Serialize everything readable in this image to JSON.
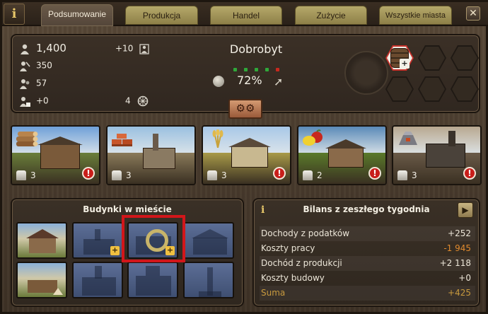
{
  "tabs": [
    {
      "label": "Podsumowanie",
      "active": true
    },
    {
      "label": "Produkcja",
      "active": false
    },
    {
      "label": "Handel",
      "active": false
    },
    {
      "label": "Zużycie",
      "active": false
    },
    {
      "label": "Wszystkie miasta",
      "active": false
    }
  ],
  "info_glyph": "i",
  "close_glyph": "✕",
  "summary": {
    "population": "1,400",
    "population_change": "+10",
    "workers": "350",
    "citizens": "57",
    "newcomers": "+0",
    "carts": "4",
    "title": "Dobrobyt",
    "prosperity_percent": "72%",
    "prosperity_dots": [
      "#2fa83a",
      "#2fa83a",
      "#2fa83a",
      "#2fa83a",
      "#c8281e"
    ],
    "gear_glyph": "⚙⚙"
  },
  "trade_slots": {
    "active_good_plus": "+"
  },
  "buildings": [
    {
      "name": "lumberjack",
      "count": "3",
      "warning": true,
      "icon": "logs-icon",
      "sky": "#6fa0d8",
      "ground": "#6a7f3a"
    },
    {
      "name": "brickworks",
      "count": "3",
      "warning": false,
      "icon": "bricks-icon",
      "sky": "#9ac0e0",
      "ground": "#8a7a5a"
    },
    {
      "name": "farm",
      "count": "3",
      "warning": true,
      "icon": "wheat-icon",
      "sky": "#a8c8e8",
      "ground": "#a89a48"
    },
    {
      "name": "orchard",
      "count": "2",
      "warning": true,
      "icon": "fruit-icon",
      "sky": "#5a8ab8",
      "ground": "#5a7a2a"
    },
    {
      "name": "smelter",
      "count": "3",
      "warning": true,
      "icon": "iron-icon",
      "sky": "#b8a890",
      "ground": "#6a5a48"
    }
  ],
  "warning_glyph": "!",
  "city_buildings": {
    "title": "Budynki w mieście",
    "plus": "+"
  },
  "balance": {
    "title": "Bilans z zeszłego tygodnia",
    "next_glyph": "▶",
    "rows": [
      {
        "label": "Dochody z podatków",
        "value": "+252",
        "negative": false
      },
      {
        "label": "Koszty pracy",
        "value": "-1 945",
        "negative": true
      },
      {
        "label": "Dochód z produkcji",
        "value": "+2 118",
        "negative": false
      },
      {
        "label": "Koszty budowy",
        "value": "+0",
        "negative": false
      },
      {
        "label": "Suma",
        "value": "+425",
        "negative": false
      }
    ]
  },
  "colors": {
    "wood": "#4a3c2e",
    "tab_inactive": "#b5a86a",
    "warning_red": "#c81e1a",
    "highlight_red": "#d2161a",
    "negative_orange": "#e08a2e",
    "sum_gold": "#c89a3e"
  }
}
